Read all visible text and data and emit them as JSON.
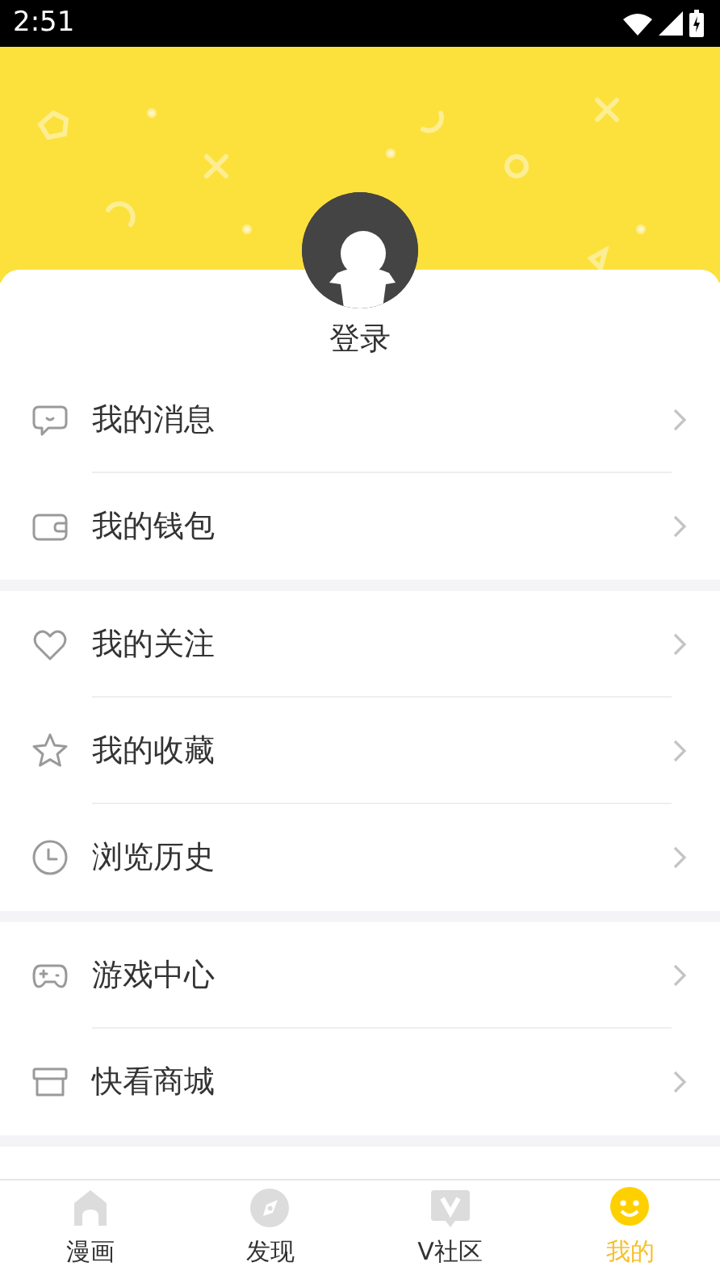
{
  "status_bar": {
    "time": "2:51"
  },
  "profile": {
    "login_label": "登录"
  },
  "menu_groups": [
    {
      "items": [
        {
          "kind": "message",
          "label": "我的消息"
        },
        {
          "kind": "wallet",
          "label": "我的钱包"
        }
      ]
    },
    {
      "items": [
        {
          "kind": "heart",
          "label": "我的关注"
        },
        {
          "kind": "star",
          "label": "我的收藏"
        },
        {
          "kind": "clock",
          "label": "浏览历史"
        }
      ]
    },
    {
      "items": [
        {
          "kind": "gamepad",
          "label": "游戏中心"
        },
        {
          "kind": "store",
          "label": "快看商城"
        }
      ]
    }
  ],
  "tabs": [
    {
      "kind": "comics",
      "label": "漫画",
      "selected": false
    },
    {
      "kind": "discover",
      "label": "发现",
      "selected": false
    },
    {
      "kind": "community",
      "label": "V社区",
      "selected": false
    },
    {
      "kind": "me",
      "label": "我的",
      "selected": true
    }
  ]
}
